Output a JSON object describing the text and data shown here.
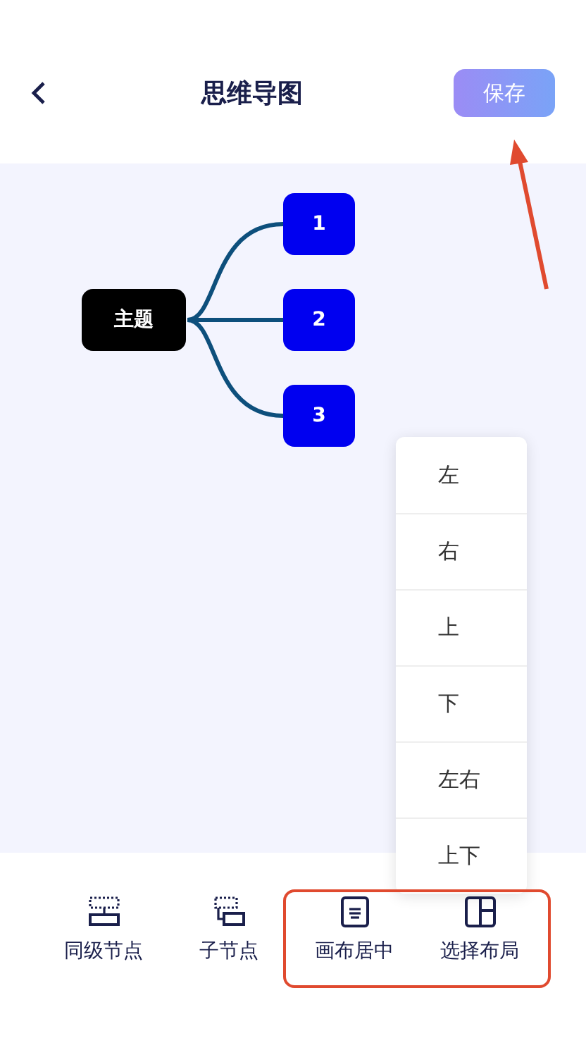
{
  "header": {
    "title": "思维导图",
    "save_button": "保存"
  },
  "mind_map": {
    "root": "主题",
    "children": [
      {
        "label": "1"
      },
      {
        "label": "2"
      },
      {
        "label": "3"
      }
    ]
  },
  "layout_menu": {
    "items": [
      "左",
      "右",
      "上",
      "下",
      "左右",
      "上下"
    ]
  },
  "toolbar": {
    "items": [
      {
        "label": "同级节点",
        "kind": "sibling"
      },
      {
        "label": "子节点",
        "kind": "child"
      },
      {
        "label": "画布居中",
        "kind": "center"
      },
      {
        "label": "选择布局",
        "kind": "layout"
      }
    ]
  }
}
